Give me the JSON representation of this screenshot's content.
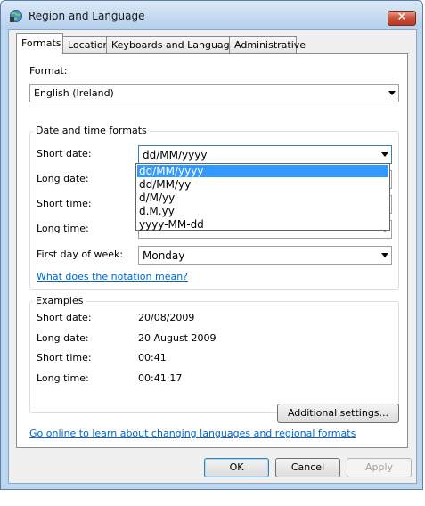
{
  "window": {
    "title": "Region and Language",
    "close_glyph": "✕"
  },
  "tabs": [
    {
      "label": "Formats",
      "active": true
    },
    {
      "label": "Location",
      "active": false
    },
    {
      "label": "Keyboards and Languages",
      "active": false
    },
    {
      "label": "Administrative",
      "active": false
    }
  ],
  "formats": {
    "format_label": "Format:",
    "format_value": "English (Ireland)",
    "datetime_group_title": "Date and time formats",
    "rows": {
      "short_date": {
        "label": "Short date:",
        "value": "dd/MM/yyyy"
      },
      "long_date": {
        "label": "Long date:"
      },
      "short_time": {
        "label": "Short time:"
      },
      "long_time": {
        "label": "Long time:"
      },
      "first_day": {
        "label": "First day of week:",
        "value": "Monday"
      }
    },
    "short_date_options": [
      "dd/MM/yyyy",
      "dd/MM/yy",
      "d/M/yy",
      "d.M.yy",
      "yyyy-MM-dd"
    ],
    "short_date_selected_index": 0,
    "notation_link": "What does the notation mean?",
    "examples_title": "Examples",
    "examples": [
      {
        "label": "Short date:",
        "value": "20/08/2009"
      },
      {
        "label": "Long date:",
        "value": "20 August 2009"
      },
      {
        "label": "Short time:",
        "value": "00:41"
      },
      {
        "label": "Long time:",
        "value": "00:41:17"
      }
    ],
    "additional_settings": "Additional settings...",
    "online_link": "Go online to learn about changing languages and regional formats"
  },
  "buttons": {
    "ok": "OK",
    "cancel": "Cancel",
    "apply": "Apply"
  },
  "colors": {
    "link": "#0066cc",
    "selection": "#3399ff",
    "close": "#c8503b"
  }
}
